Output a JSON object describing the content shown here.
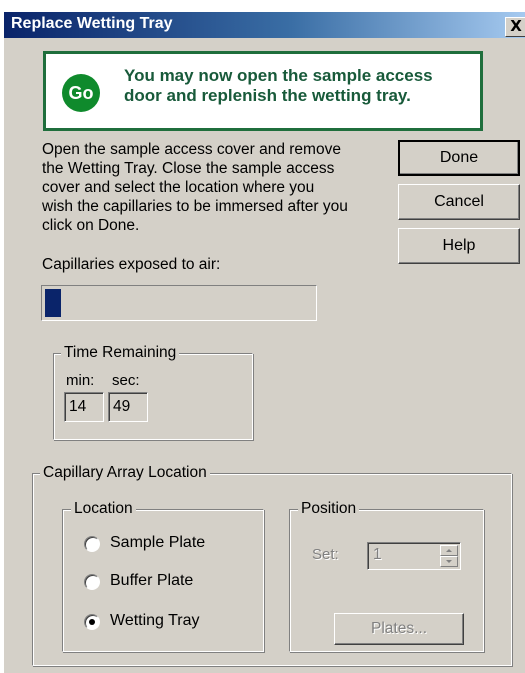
{
  "window": {
    "title": "Replace Wetting Tray",
    "close_label": "X"
  },
  "banner": {
    "icon_label": "Go",
    "line1": "You may now open the sample access",
    "line2": "door and replenish the wetting tray.",
    "accent_color": "#1f6e3c"
  },
  "instructions": {
    "line1": "Open the sample access cover and remove",
    "line2": "the Wetting Tray. Close the sample access",
    "line3": "cover and select the location where you",
    "line4": "wish the capillaries to be immersed after you",
    "line5": "click on Done."
  },
  "buttons": {
    "done": "Done",
    "cancel": "Cancel",
    "help": "Help"
  },
  "exposure": {
    "label": "Capillaries exposed to air:",
    "progress_fraction": 0.06,
    "bar_color": "#0a246a"
  },
  "time_remaining": {
    "legend": "Time Remaining",
    "min_label": "min:",
    "sec_label": "sec:",
    "min_value": "14",
    "sec_value": "49"
  },
  "capillary_array": {
    "legend": "Capillary Array Location",
    "location": {
      "legend": "Location",
      "options": [
        {
          "label": "Sample Plate",
          "selected": false
        },
        {
          "label": "Buffer Plate",
          "selected": false
        },
        {
          "label": "Wetting Tray",
          "selected": true
        }
      ]
    },
    "position": {
      "legend": "Position",
      "set_label": "Set:",
      "set_value": "1",
      "plates_button": "Plates..."
    }
  }
}
